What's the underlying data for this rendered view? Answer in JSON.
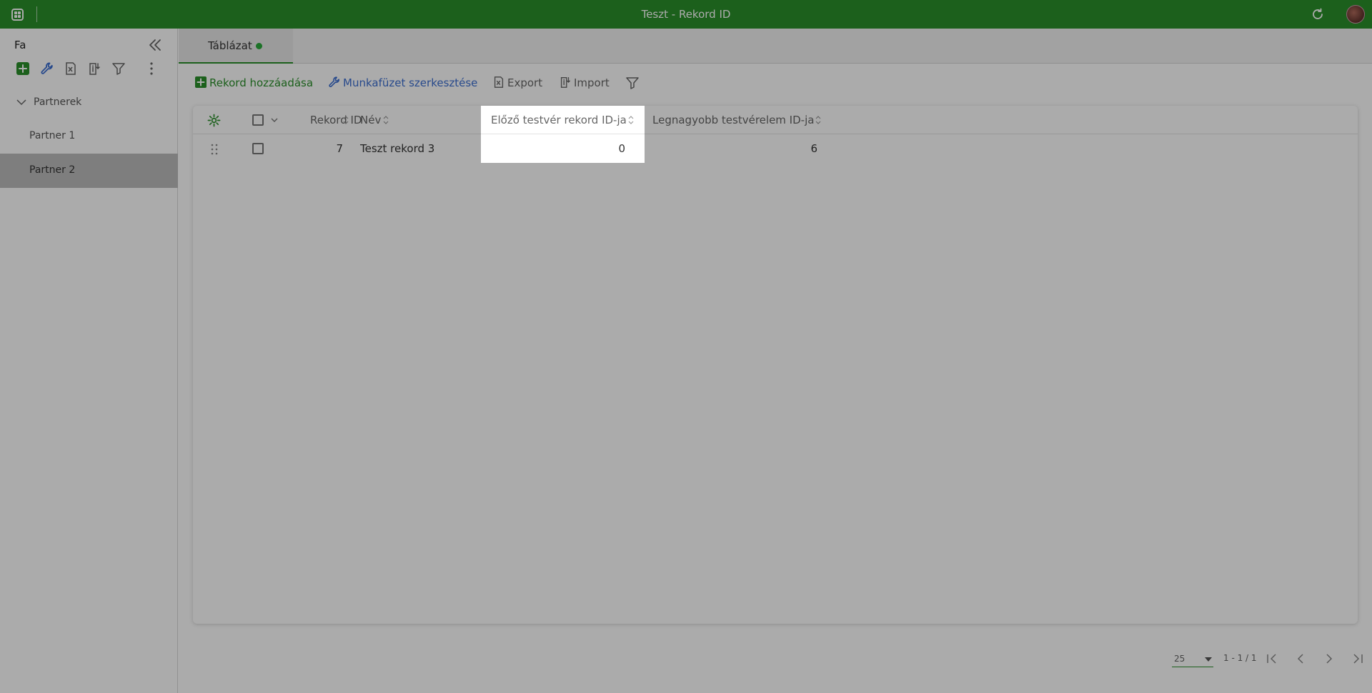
{
  "app": {
    "title": "Teszt - Rekord ID"
  },
  "sidebar": {
    "title": "Fa",
    "group_label": "Partnerek",
    "items": [
      {
        "label": "Partner 1",
        "selected": false
      },
      {
        "label": "Partner 2",
        "selected": true
      }
    ]
  },
  "tabs": [
    {
      "label": "Táblázat",
      "status_color": "#2bab3b"
    }
  ],
  "toolbar": {
    "add_record": "Rekord hozzáadása",
    "edit_workbook": "Munkafüzet szerkesztése",
    "export": "Export",
    "import": "Import"
  },
  "table": {
    "columns": {
      "record_id": "Rekord ID",
      "name": "Név",
      "prev_sibling_id": "Előző testvér rekord ID-ja",
      "largest_sibling_id": "Legnagyobb testvérelem ID-ja"
    },
    "rows": [
      {
        "record_id": "7",
        "name": "Teszt rekord 3",
        "prev_sibling_id": "0",
        "largest_sibling_id": "6"
      }
    ]
  },
  "pager": {
    "page_size": "25",
    "info": "1 - 1 / 1"
  },
  "colors": {
    "brand": "#2b8f2b",
    "link_blue": "#3d6fd1"
  }
}
